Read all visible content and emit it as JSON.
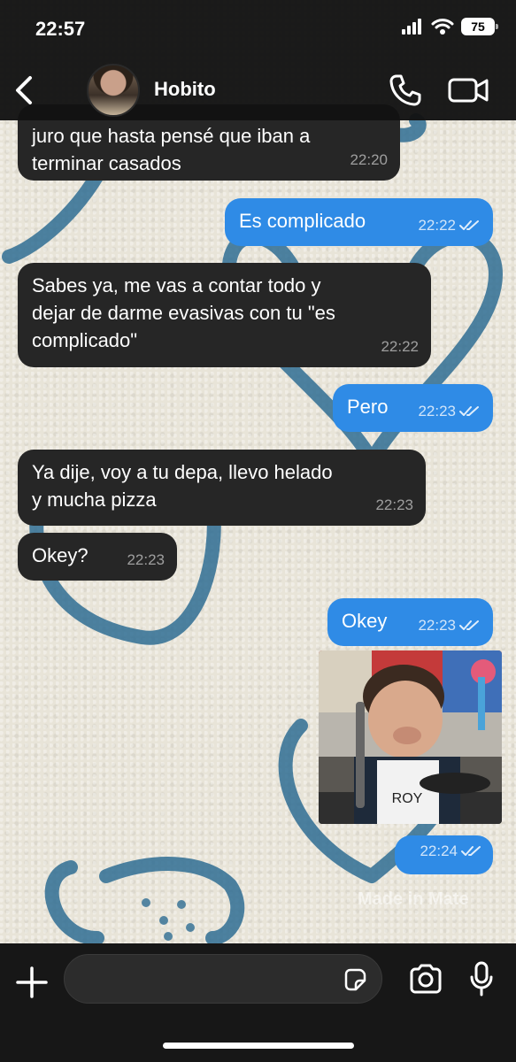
{
  "status_bar": {
    "time": "22:57",
    "battery": "75"
  },
  "header": {
    "contact_name": "Hobito"
  },
  "messages": [
    {
      "dir": "in",
      "text": "juro que hasta pensé que iban a\nterminar casados",
      "time": "22:20"
    },
    {
      "dir": "out",
      "text": "Es complicado",
      "time": "22:22"
    },
    {
      "dir": "in",
      "text": "Sabes ya, me vas a contar todo y\ndejar de darme evasivas con tu \"es\ncomplicado\"",
      "time": "22:22"
    },
    {
      "dir": "out",
      "text": "Pero",
      "time": "22:23"
    },
    {
      "dir": "in",
      "text": "Ya dije, voy a tu depa, llevo helado\ny mucha pizza",
      "time": "22:23"
    },
    {
      "dir": "in",
      "text": "Okey?",
      "time": "22:23"
    },
    {
      "dir": "out",
      "text": "Okey",
      "time": "22:23"
    },
    {
      "dir": "out",
      "text": "",
      "time": "22:24"
    }
  ],
  "image_message": {
    "apron_text": "ROY"
  },
  "watermark": "Made in Mate",
  "composer": {
    "placeholder": ""
  },
  "colors": {
    "outgoing": "#2f8be6",
    "incoming": "#262626",
    "header": "#121212"
  },
  "icons": [
    "back-icon",
    "phone-icon",
    "video-icon",
    "plus-icon",
    "sticker-icon",
    "camera-icon",
    "mic-icon",
    "double-check-icon"
  ]
}
